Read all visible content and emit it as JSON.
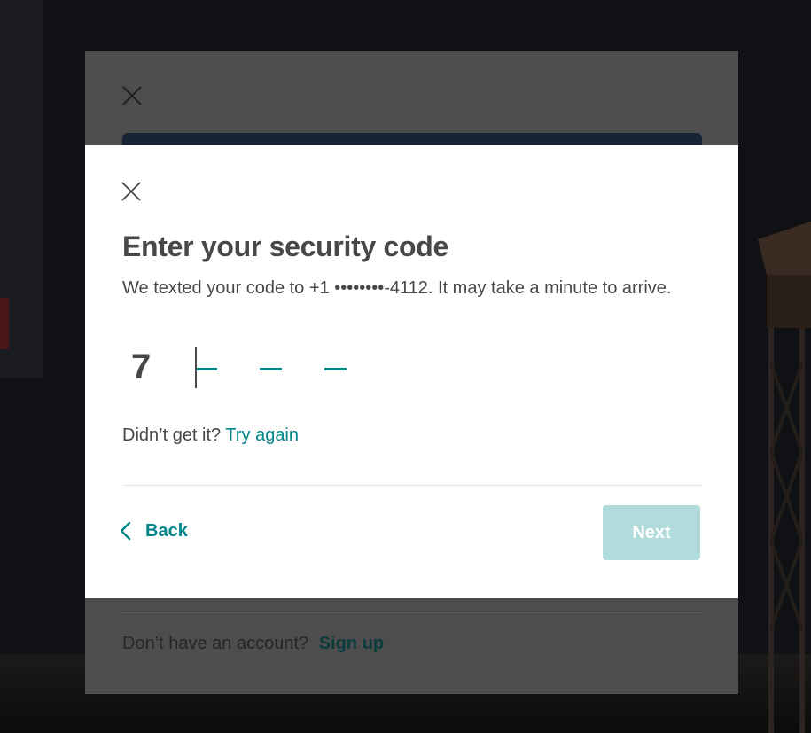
{
  "background_modal": {
    "signup_prompt": "Don’t have an account?",
    "signup_link": "Sign up"
  },
  "dialog": {
    "title": "Enter your security code",
    "subtitle": "We texted your code to +1 ••••••••-4112. It may take a minute to arrive.",
    "code_digits": [
      "7",
      "",
      "",
      ""
    ],
    "retry_prompt": "Didn’t get it?",
    "retry_link": "Try again",
    "back_label": "Back",
    "next_label": "Next",
    "next_enabled": false
  },
  "icons": {
    "close": "close-icon",
    "back": "chevron-left-icon"
  },
  "colors": {
    "accent": "#00858A",
    "next_disabled_bg": "#B2DBDC",
    "text": "#484848"
  }
}
